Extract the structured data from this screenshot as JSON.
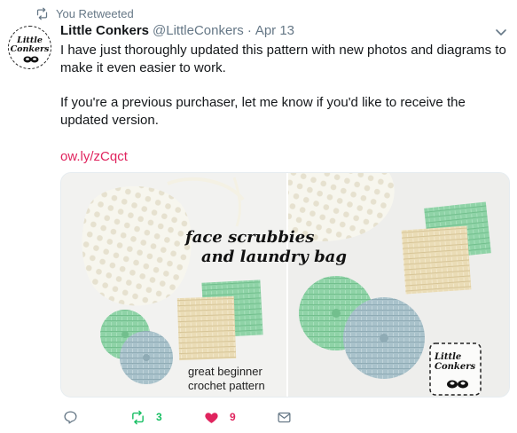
{
  "retweet_context": {
    "icon": "retweet-icon",
    "label": "You Retweeted"
  },
  "author": {
    "avatar_text_line1": "Little",
    "avatar_text_line2": "Conkers",
    "name": "Little Conkers",
    "handle": "@LittleConkers",
    "separator": "·",
    "date": "Apr 13"
  },
  "tweet": {
    "paragraph1": "I have just thoroughly updated this pattern with new photos and diagrams to make it even easier to work.",
    "paragraph2": "If you're a previous purchaser, let me know if you'd like to receive the updated version.",
    "link": "ow.ly/zCqct"
  },
  "media": {
    "title_line1": "face scrubbies",
    "title_line2": "and laundry bag",
    "caption_line1": "great beginner",
    "caption_line2": "crochet pattern",
    "logo_line1": "Little",
    "logo_line2": "Conkers"
  },
  "actions": {
    "reply": {
      "icon": "reply-icon",
      "count": ""
    },
    "retweet": {
      "icon": "retweet-icon",
      "count": "3",
      "color": "#17bf63"
    },
    "like": {
      "icon": "heart-icon",
      "count": "9",
      "color": "#e0245e"
    },
    "message": {
      "icon": "envelope-icon"
    }
  },
  "colors": {
    "link": "#e0245e",
    "secondary_text": "#657786",
    "primary_text": "#14171a"
  }
}
